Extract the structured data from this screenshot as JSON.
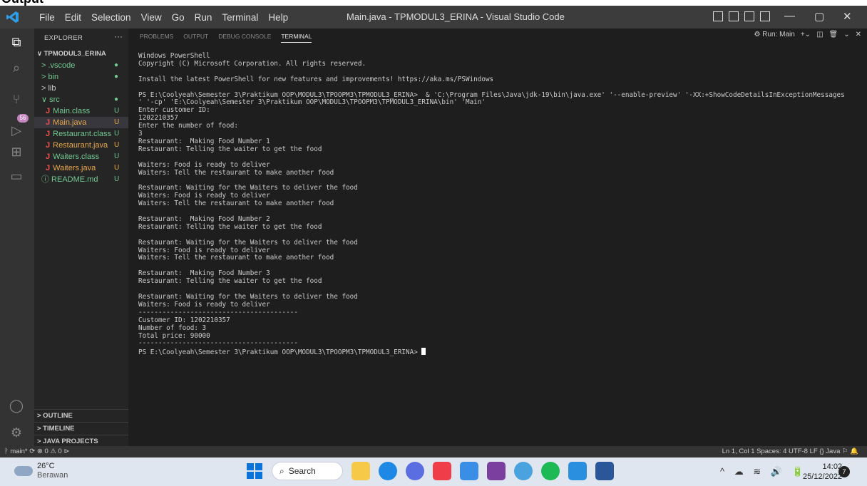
{
  "page_top_fragment": "Output",
  "titlebar": {
    "menu": [
      "File",
      "Edit",
      "Selection",
      "View",
      "Go",
      "Run",
      "Terminal",
      "Help"
    ],
    "window_title": "Main.java - TPMODUL3_ERINA - Visual Studio Code"
  },
  "activity_badge": "56",
  "explorer": {
    "header": "EXPLORER",
    "more": "···",
    "root": "TPMODUL3_ERINA",
    "items": [
      {
        "label": "> .vscode",
        "status": "●",
        "color": "#73c991"
      },
      {
        "label": "> bin",
        "status": "●",
        "color": "#73c991"
      },
      {
        "label": "> lib",
        "status": "",
        "color": "#cccccc"
      },
      {
        "label": "∨ src",
        "status": "●",
        "color": "#73c991"
      },
      {
        "label": "Main.class",
        "status": "U",
        "color": "#73c991",
        "java": true
      },
      {
        "label": "Main.java",
        "status": "U",
        "color": "#e8a84a",
        "java": true,
        "selected": true
      },
      {
        "label": "Restaurant.class",
        "status": "U",
        "color": "#73c991",
        "java": true
      },
      {
        "label": "Restaurant.java",
        "status": "U",
        "color": "#e8a84a",
        "java": true
      },
      {
        "label": "Waiters.class",
        "status": "U",
        "color": "#73c991",
        "java": true
      },
      {
        "label": "Waiters.java",
        "status": "U",
        "color": "#e8a84a",
        "java": true
      },
      {
        "label": "ⓘ README.md",
        "status": "U",
        "color": "#73c991"
      }
    ],
    "sections": [
      "> OUTLINE",
      "> TIMELINE",
      "> JAVA PROJECTS"
    ]
  },
  "panel": {
    "tabs": [
      "PROBLEMS",
      "OUTPUT",
      "DEBUG CONSOLE",
      "TERMINAL"
    ],
    "run_label": "Run: Main",
    "terminal_lines": [
      "Windows PowerShell",
      "Copyright (C) Microsoft Corporation. All rights reserved.",
      "",
      "Install the latest PowerShell for new features and improvements! https://aka.ms/PSWindows",
      "",
      "PS E:\\Coolyeah\\Semester 3\\Praktikum OOP\\MODUL3\\TPOOPM3\\TPMODUL3_ERINA>  & 'C:\\Program Files\\Java\\jdk-19\\bin\\java.exe' '--enable-preview' '-XX:+ShowCodeDetailsInExceptionMessages",
      "' '-cp' 'E:\\Coolyeah\\Semester 3\\Praktikum OOP\\MODUL3\\TPOOPM3\\TPMODUL3_ERINA\\bin' 'Main'",
      "Enter customer ID:",
      "1202210357",
      "Enter the number of food:",
      "3",
      "Restaurant:  Making Food Number 1",
      "Restaurant: Telling the waiter to get the food",
      "",
      "Waiters: Food is ready to deliver",
      "Waiters: Tell the restaurant to make another food",
      "",
      "Restaurant: Waiting for the Waiters to deliver the food",
      "Waiters: Food is ready to deliver",
      "Waiters: Tell the restaurant to make another food",
      "",
      "Restaurant:  Making Food Number 2",
      "Restaurant: Telling the waiter to get the food",
      "",
      "Restaurant: Waiting for the Waiters to deliver the food",
      "Waiters: Food is ready to deliver",
      "Waiters: Tell the restaurant to make another food",
      "",
      "Restaurant:  Making Food Number 3",
      "Restaurant: Telling the waiter to get the food",
      "",
      "Restaurant: Waiting for the Waiters to deliver the food",
      "Waiters: Food is ready to deliver",
      "----------------------------------------",
      "Customer ID: 1202210357",
      "Number of food: 3",
      "Total price: 90000",
      "----------------------------------------",
      "PS E:\\Coolyeah\\Semester 3\\Praktikum OOP\\MODUL3\\TPOOPM3\\TPMODUL3_ERINA> "
    ]
  },
  "statusbar": {
    "left": "ᚹ main*  ⟳  ⊗ 0 ⚠ 0  ⊳",
    "right": "Ln 1, Col 1   Spaces: 4   UTF-8   LF   {} Java   ⚐   🔔"
  },
  "taskbar": {
    "temp": "26°C",
    "weather": "Berawan",
    "search": "Search",
    "time": "14:02",
    "date": "25/12/2022",
    "notifications": "7"
  }
}
